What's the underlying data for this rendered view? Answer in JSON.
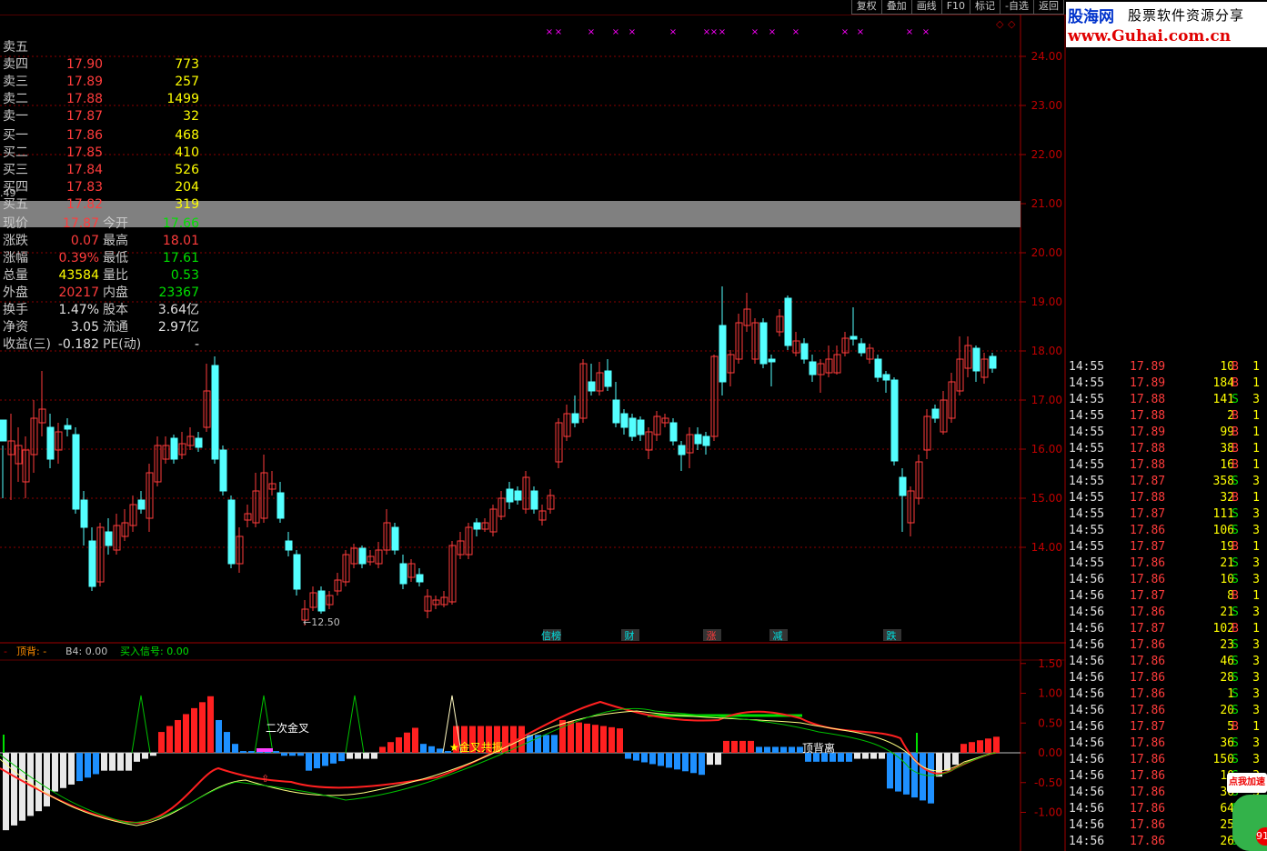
{
  "toolbar": {
    "buttons": [
      "复权",
      "叠加",
      "画线",
      "F10",
      "标记",
      "-自选",
      "返回"
    ]
  },
  "logo": {
    "name": "股海网",
    "slogan": "股票软件资源分享",
    "url": "www.Guhai.com.cn"
  },
  "main_chart": {
    "price_axis": [
      "24.00",
      "23.00",
      "22.00",
      "21.00",
      "20.00",
      "19.00",
      "18.00",
      "17.00",
      "16.00",
      "15.00",
      "14.00"
    ],
    "left_label": ".49",
    "low_label": "←12.50",
    "event_labels": [
      "信榜",
      "财",
      "涨",
      "减",
      "跌"
    ],
    "marker_char": "×"
  },
  "indicator": {
    "legend_top": "顶背: -",
    "legend_b4": "B4: 0.00",
    "legend_buy": "买入信号: 0.00",
    "axis": [
      "1.50",
      "1.00",
      "0.50",
      "0.00",
      "-0.50",
      "-1.00"
    ],
    "annotations": [
      "二次金叉",
      "★金叉共振",
      "顶背离"
    ]
  },
  "quote": {
    "sell": [
      {
        "label": "卖五",
        "price": "",
        "vol": ""
      },
      {
        "label": "卖四",
        "price": "17.90",
        "vol": "773"
      },
      {
        "label": "卖三",
        "price": "17.89",
        "vol": "257"
      },
      {
        "label": "卖二",
        "price": "17.88",
        "vol": "1499"
      },
      {
        "label": "卖一",
        "price": "17.87",
        "vol": "32"
      }
    ],
    "buy": [
      {
        "label": "买一",
        "price": "17.86",
        "vol": "468"
      },
      {
        "label": "买二",
        "price": "17.85",
        "vol": "410"
      },
      {
        "label": "买三",
        "price": "17.84",
        "vol": "526"
      },
      {
        "label": "买四",
        "price": "17.83",
        "vol": "204"
      },
      {
        "label": "买五",
        "price": "17.82",
        "vol": "319"
      }
    ],
    "stats": [
      {
        "l1": "现价",
        "v1": "17.87",
        "c1": "red",
        "l2": "今开",
        "v2": "17.66",
        "c2": "green"
      },
      {
        "l1": "涨跌",
        "v1": "0.07",
        "c1": "red",
        "l2": "最高",
        "v2": "18.01",
        "c2": "red"
      },
      {
        "l1": "涨幅",
        "v1": "0.39%",
        "c1": "red",
        "l2": "最低",
        "v2": "17.61",
        "c2": "green"
      },
      {
        "l1": "总量",
        "v1": "43584",
        "c1": "yellow",
        "l2": "量比",
        "v2": "0.53",
        "c2": "green"
      },
      {
        "l1": "外盘",
        "v1": "20217",
        "c1": "red",
        "l2": "内盘",
        "v2": "23367",
        "c2": "green"
      },
      {
        "l1": "换手",
        "v1": "1.47%",
        "c1": "white",
        "l2": "股本",
        "v2": "3.64亿",
        "c2": "white"
      },
      {
        "l1": "净资",
        "v1": "3.05",
        "c1": "white",
        "l2": "流通",
        "v2": "2.97亿",
        "c2": "white"
      },
      {
        "l1": "收益(三)",
        "v1": "-0.182",
        "c1": "white",
        "l2": "PE(动)",
        "v2": "-",
        "c2": "white"
      }
    ]
  },
  "ticks": [
    {
      "t": "14:55",
      "p": "17.89",
      "v": "10",
      "s": "B"
    },
    {
      "t": "14:55",
      "p": "17.89",
      "v": "184",
      "s": "B"
    },
    {
      "t": "14:55",
      "p": "17.88",
      "v": "141",
      "s": "S"
    },
    {
      "t": "14:55",
      "p": "17.88",
      "v": "2",
      "s": "B"
    },
    {
      "t": "14:55",
      "p": "17.89",
      "v": "99",
      "s": "B"
    },
    {
      "t": "14:55",
      "p": "17.88",
      "v": "38",
      "s": "B"
    },
    {
      "t": "14:55",
      "p": "17.88",
      "v": "16",
      "s": "B"
    },
    {
      "t": "14:55",
      "p": "17.87",
      "v": "358",
      "s": "S"
    },
    {
      "t": "14:55",
      "p": "17.88",
      "v": "32",
      "s": "B"
    },
    {
      "t": "14:55",
      "p": "17.87",
      "v": "111",
      "s": "S"
    },
    {
      "t": "14:55",
      "p": "17.86",
      "v": "106",
      "s": "S"
    },
    {
      "t": "14:55",
      "p": "17.87",
      "v": "19",
      "s": "B"
    },
    {
      "t": "14:55",
      "p": "17.86",
      "v": "21",
      "s": "S"
    },
    {
      "t": "14:56",
      "p": "17.86",
      "v": "10",
      "s": "S"
    },
    {
      "t": "14:56",
      "p": "17.87",
      "v": "8",
      "s": "B"
    },
    {
      "t": "14:56",
      "p": "17.86",
      "v": "21",
      "s": "S"
    },
    {
      "t": "14:56",
      "p": "17.87",
      "v": "102",
      "s": "B"
    },
    {
      "t": "14:56",
      "p": "17.86",
      "v": "23",
      "s": "S"
    },
    {
      "t": "14:56",
      "p": "17.86",
      "v": "46",
      "s": "S"
    },
    {
      "t": "14:56",
      "p": "17.86",
      "v": "28",
      "s": "S"
    },
    {
      "t": "14:56",
      "p": "17.86",
      "v": "1",
      "s": "S"
    },
    {
      "t": "14:56",
      "p": "17.86",
      "v": "20",
      "s": "S"
    },
    {
      "t": "14:56",
      "p": "17.87",
      "v": "5",
      "s": "B"
    },
    {
      "t": "14:56",
      "p": "17.86",
      "v": "36",
      "s": "S"
    },
    {
      "t": "14:56",
      "p": "17.86",
      "v": "150",
      "s": "S"
    },
    {
      "t": "14:56",
      "p": "17.86",
      "v": "10",
      "s": "S"
    },
    {
      "t": "14:56",
      "p": "17.86",
      "v": "36",
      "s": "S"
    },
    {
      "t": "14:56",
      "p": "17.86",
      "v": "64",
      "s": "S"
    },
    {
      "t": "14:56",
      "p": "17.86",
      "v": "25",
      "s": "S"
    },
    {
      "t": "14:56",
      "p": "17.86",
      "v": "26",
      "s": "S"
    }
  ],
  "ad_text": "点我加速",
  "badge_text": "91",
  "colors": {
    "up": "#ff3c3c",
    "down": "#54ffff",
    "grid": "#8b0000",
    "accent": "#ff00ff"
  }
}
